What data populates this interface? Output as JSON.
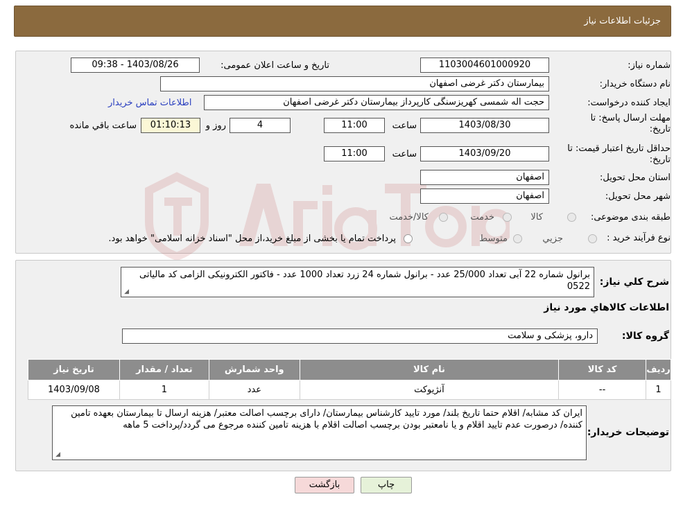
{
  "header": {
    "title": "جزئیات اطلاعات نیاز"
  },
  "fields": {
    "need_number_label": "شماره نیاز:",
    "need_number": "1103004601000920",
    "announce_label": "تاریخ و ساعت اعلان عمومی:",
    "announce_value": "1403/08/26 - 09:38",
    "buyer_label": "نام دستگاه خریدار:",
    "buyer_value": "بیمارستان دکتر غرضی اصفهان",
    "creator_label": "ایجاد کننده درخواست:",
    "creator_value": "حجت اله شمسی کهریزسنگی کارپرداز بیمارستان دکتر غرضی اصفهان",
    "contact_link": "اطلاعات تماس خریدار",
    "deadline_label": "مهلت ارسال پاسخ: تا تاریخ:",
    "deadline_date": "1403/08/30",
    "time_label": "ساعت",
    "deadline_time": "11:00",
    "days_value": "4",
    "days_label": "روز و",
    "remaining_value": "01:10:13",
    "remaining_label": "ساعت باقي مانده",
    "validity_label": "حداقل تاریخ اعتبار قیمت: تا تاریخ:",
    "validity_date": "1403/09/20",
    "validity_time": "11:00",
    "province_label": "استان محل تحویل:",
    "province_value": "اصفهان",
    "city_label": "شهر محل تحویل:",
    "city_value": "اصفهان",
    "category_label": "طبقه بندی موضوعی:",
    "category_options": [
      "کالا",
      "خدمت",
      "کالا/خدمت"
    ],
    "process_label": "نوع فرآیند خرید :",
    "process_options": [
      "جزیي",
      "متوسط"
    ],
    "process_note": "پرداخت تمام یا بخشی از مبلغ خرید،از محل \"اسناد خزانه اسلامی\" خواهد بود."
  },
  "description": {
    "label": "شرح کلي نياز:",
    "text": "برانول شماره 22 آبی تعداد 25/000 عدد - برانول شماره 24 زرد تعداد 1000 عدد -  فاکتور الکترونیکی الزامی کد مالیاتی 0522"
  },
  "goods": {
    "section_title": "اطلاعات کالاهاي مورد نياز",
    "group_label": "گروه کالا:",
    "group_value": "دارو، پزشکی و سلامت"
  },
  "table": {
    "headers": [
      "رديف",
      "کد کالا",
      "نام کالا",
      "واحد شمارش",
      "تعداد / مقدار",
      "تاریخ نیاز"
    ],
    "rows": [
      [
        "1",
        "--",
        "آنژیوکت",
        "عدد",
        "1",
        "1403/09/08"
      ]
    ]
  },
  "buyer_notes": {
    "label": "توضیحات خریدار:",
    "text": "ایران کد مشابه/ اقلام حتما تاریخ بلند/ مورد تایید کارشناس بیمارستان/ دارای برچسب اصالت معتبر/ هزینه ارسال تا بیمارستان بعهده تامین کننده/ درصورت عدم تایید اقلام و یا نامعتبر بودن برچسب اصالت اقلام با هزینه تامین کننده مرجوع می گردد/پرداخت 5 ماهه"
  },
  "buttons": {
    "print": "چاپ",
    "back": "بازگشت"
  },
  "colors": {
    "header": "#8b6a3e",
    "table_header": "#8d8d8d",
    "link": "#2a3fbf"
  }
}
